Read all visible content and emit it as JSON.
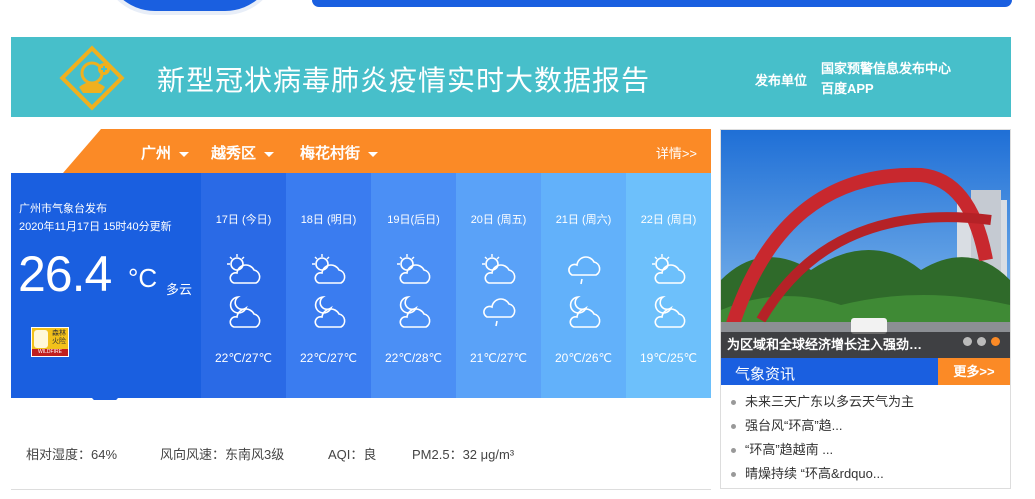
{
  "banner": {
    "title": "新型冠状病毒肺炎疫情实时大数据报告",
    "publisher_label": "发布单位",
    "publishers": [
      "国家预警信息发布中心",
      "百度APP"
    ]
  },
  "location": {
    "city": "广州",
    "district": "越秀区",
    "street": "梅花村街",
    "detail_link": "详情>>"
  },
  "current": {
    "publisher": "广州市气象台发布",
    "updated": "2020年11月17日 15时40分更新",
    "temperature": "26.4",
    "unit": "°C",
    "condition": "多云",
    "alert_icon": "forest-fire-warning-icon"
  },
  "forecast": [
    {
      "date": "17日 (今日)",
      "day_icon": "partly-cloudy-icon",
      "night_icon": "cloudy-night-icon",
      "temp": "22℃/27℃",
      "color": "#2a6ae6"
    },
    {
      "date": "18日 (明日)",
      "day_icon": "partly-cloudy-icon",
      "night_icon": "cloudy-night-icon",
      "temp": "22℃/27℃",
      "color": "#3a7cf0"
    },
    {
      "date": "19日(后日)",
      "day_icon": "partly-cloudy-icon",
      "night_icon": "cloudy-night-icon",
      "temp": "22℃/28℃",
      "color": "#4b8ff5"
    },
    {
      "date": "20日 (周五)",
      "day_icon": "partly-cloudy-icon",
      "night_icon": "light-rain-icon",
      "temp": "21℃/27℃",
      "color": "#5aa2f8"
    },
    {
      "date": "21日 (周六)",
      "day_icon": "light-rain-icon",
      "night_icon": "cloudy-night-icon",
      "temp": "20℃/26℃",
      "color": "#62b1fa"
    },
    {
      "date": "22日 (周日)",
      "day_icon": "partly-cloudy-icon",
      "night_icon": "cloudy-night-icon",
      "temp": "19℃/25℃",
      "color": "#6dc0fb"
    }
  ],
  "stats": {
    "humidity": "相对湿度：64%",
    "wind": "风向风速：东南风3级",
    "aqi": "AQI：良",
    "pm25": "PM2.5：32 μg/m³"
  },
  "sidebar": {
    "photo_caption": "为区域和全球经济增长注入强劲…",
    "slide_count": 3,
    "active_slide": 3,
    "news_title": "气象资讯",
    "news_more": "更多>>",
    "news_items": [
      "未来三天广东以多云天气为主",
      "强台风“环高”趋...",
      "“环高”趋越南 ...",
      "晴燥持续 “环高&rdquo..."
    ]
  },
  "colors": {
    "primary_blue": "#1a5fe0",
    "orange": "#fb8a26",
    "teal": "#47bfca"
  }
}
